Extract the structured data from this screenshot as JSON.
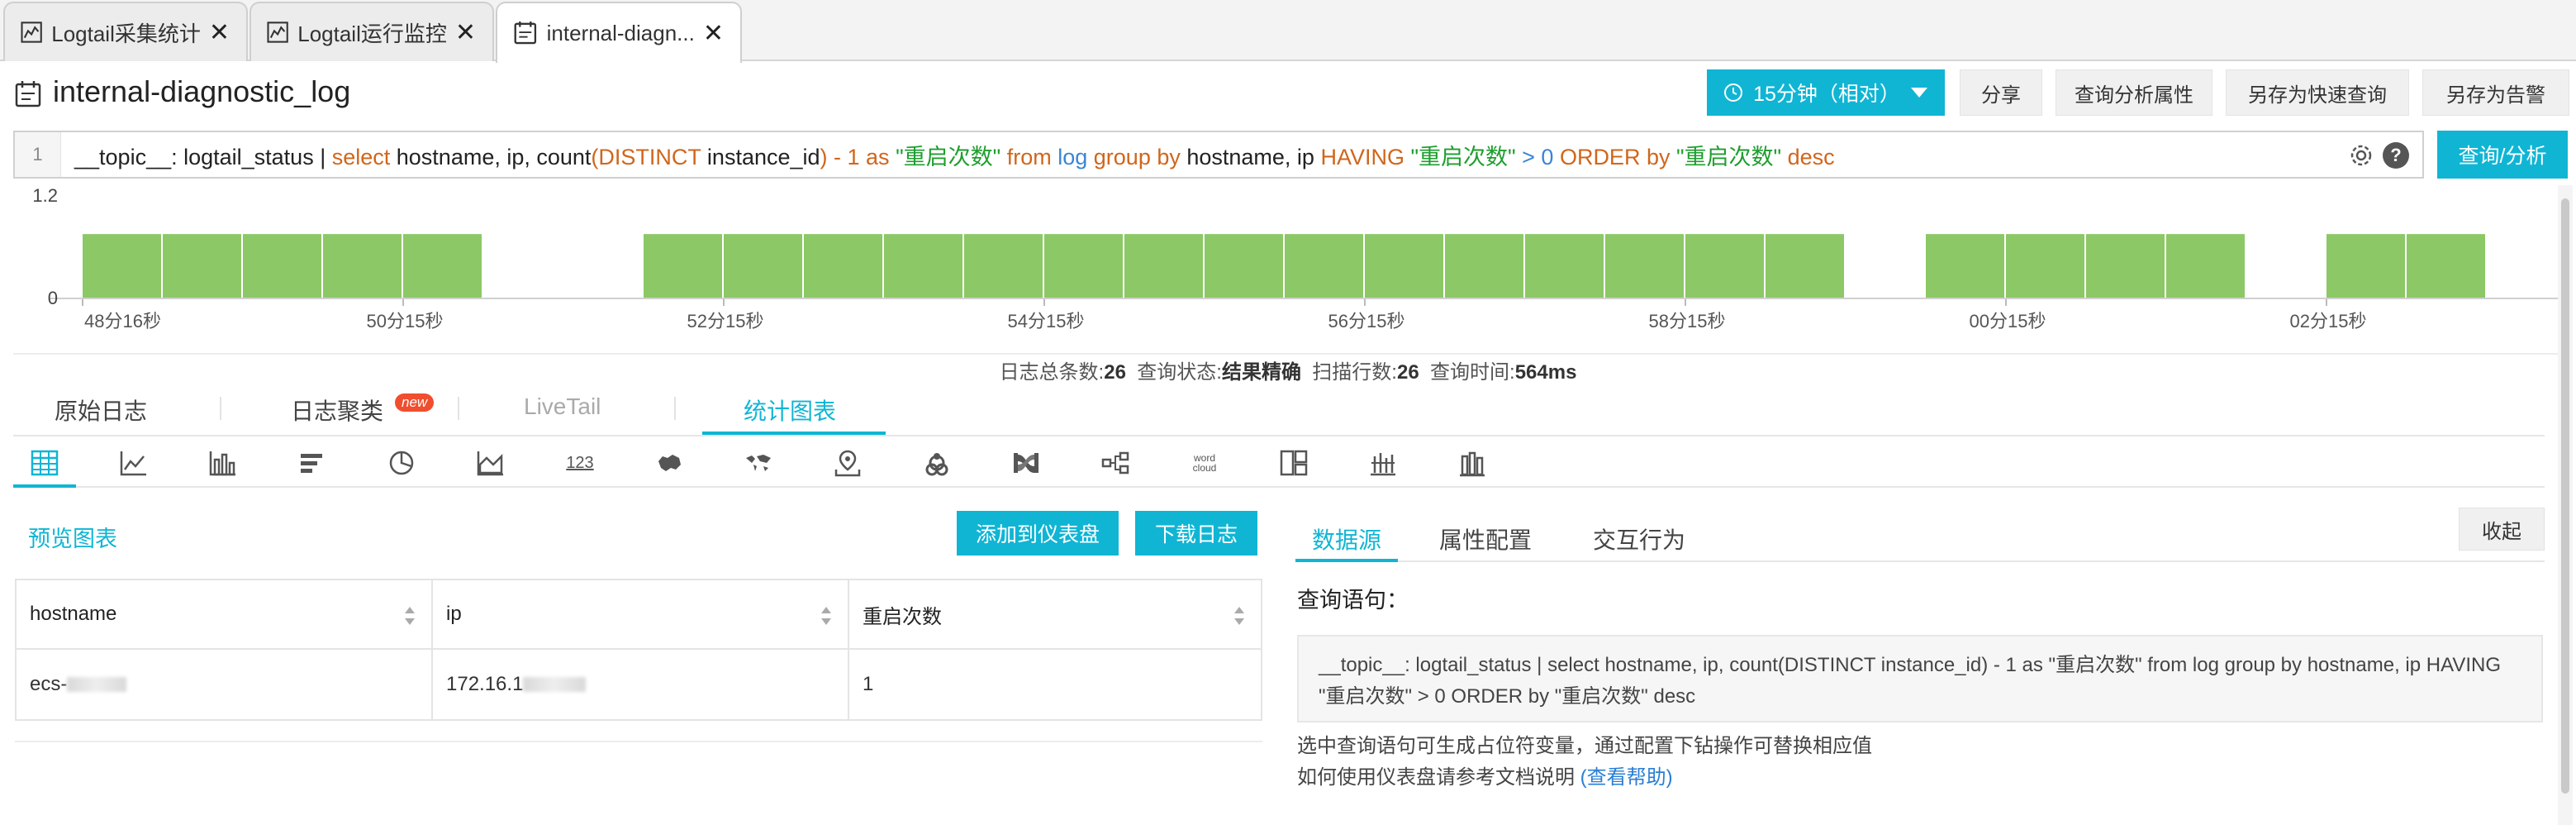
{
  "tabs": [
    {
      "label": "Logtail采集统计",
      "active": false
    },
    {
      "label": "Logtail运行监控",
      "active": false
    },
    {
      "label": "internal-diagn...",
      "active": true
    }
  ],
  "header": {
    "title": "internal-diagnostic_log",
    "time_button": "15分钟（相对）",
    "buttons": [
      "分享",
      "查询分析属性",
      "另存为快速查询",
      "另存为告警"
    ]
  },
  "query": {
    "line_number": "1",
    "tokens": [
      {
        "t": "__topic__: logtail_status | ",
        "c": "q-fn"
      },
      {
        "t": "select",
        "c": "q-kw"
      },
      {
        "t": "  hostname,  ip, count",
        "c": "q-fn"
      },
      {
        "t": "(DISTINCT",
        "c": "q-kw"
      },
      {
        "t": " instance_id",
        "c": "q-fn"
      },
      {
        "t": ") - 1 as ",
        "c": "q-kw"
      },
      {
        "t": "\"重启次数\"",
        "c": "q-str"
      },
      {
        "t": " from ",
        "c": "q-kw"
      },
      {
        "t": "log",
        "c": "q-blue"
      },
      {
        "t": " group by ",
        "c": "q-kw"
      },
      {
        "t": "hostname, ip ",
        "c": "q-fn"
      },
      {
        "t": "HAVING ",
        "c": "q-kw"
      },
      {
        "t": "\"重启次数\"",
        "c": "q-str"
      },
      {
        "t": " > 0 ",
        "c": "q-blue"
      },
      {
        "t": "ORDER  by ",
        "c": "q-kw"
      },
      {
        "t": "\"重启次数\"",
        "c": "q-str"
      },
      {
        "t": " desc",
        "c": "q-kw"
      }
    ],
    "submit_label": "查询/分析",
    "help_glyph": "?"
  },
  "histogram": {
    "y_ticks": [
      "1.2",
      "0"
    ],
    "x_labels": [
      "48分16秒",
      "50分15秒",
      "52分15秒",
      "54分15秒",
      "56分15秒",
      "58分15秒",
      "00分15秒",
      "02分15秒"
    ],
    "bar_color": "#8cc865",
    "bars": [
      1,
      1,
      1,
      1,
      1,
      0,
      0,
      1,
      1,
      1,
      1,
      1,
      1,
      1,
      1,
      1,
      1,
      1,
      1,
      1,
      1,
      1,
      0,
      1,
      1,
      1,
      1,
      0,
      1,
      1
    ]
  },
  "stats": {
    "total_label": "日志总条数:",
    "total_value": "26",
    "status_label": "查询状态:",
    "status_value": "结果精确",
    "scan_label": "扫描行数:",
    "scan_value": "26",
    "time_label": "查询时间:",
    "time_value": "564ms"
  },
  "main_tabs": [
    {
      "label": "原始日志",
      "state": "normal"
    },
    {
      "label": "日志聚类",
      "state": "normal",
      "badge": "new"
    },
    {
      "label": "LiveTail",
      "state": "disabled"
    },
    {
      "label": "统计图表",
      "state": "active"
    }
  ],
  "chart_icons": [
    "table-icon",
    "line-chart-icon",
    "bar-chart-icon",
    "horizontal-bar-icon",
    "pie-chart-icon",
    "area-chart-icon",
    "single-value-icon",
    "china-map-icon",
    "world-map-icon",
    "map-pin-icon",
    "flow-chart-icon",
    "sankey-icon",
    "topology-icon",
    "word-cloud-icon",
    "treemap-icon",
    "tracking-chart-icon",
    "column-icon"
  ],
  "single_value_text": "123",
  "word_cloud_text": "word cloud",
  "left_panel": {
    "title": "预览图表",
    "add_dashboard": "添加到仪表盘",
    "download_log": "下载日志",
    "columns": [
      "hostname",
      "ip",
      "重启次数"
    ],
    "rows": [
      {
        "hostname": "ecs-",
        "ip": "172.16.1",
        "count": "1"
      }
    ]
  },
  "right_panel": {
    "tabs": [
      "数据源",
      "属性配置",
      "交互行为"
    ],
    "collapse": "收起",
    "query_label": "查询语句：",
    "query_text": "__topic__: logtail_status | select hostname, ip, count(DISTINCT instance_id) - 1 as \"重启次数\" from log group by hostname, ip HAVING \"重启次数\" > 0 ORDER by \"重启次数\" desc",
    "hint1": "选中查询语句可生成占位符变量，通过配置下钻操作可替换相应值",
    "hint2": "如何使用仪表盘请参考文档说明",
    "hint_link": "(查看帮助)"
  },
  "colors": {
    "accent": "#10b5d4",
    "badge": "#f04e2e",
    "bar": "#8cc865"
  }
}
